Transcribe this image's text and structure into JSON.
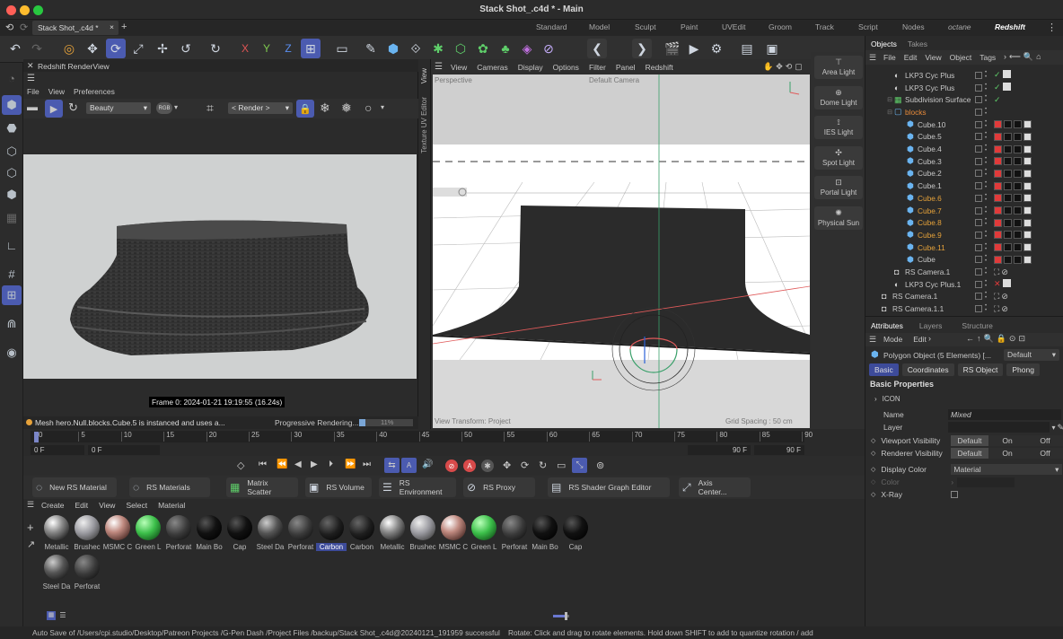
{
  "window": {
    "title": "Stack Shot_.c4d * - Main",
    "doc_tab": "Stack Shot_.c4d *",
    "add_tab": "+"
  },
  "workspaces": [
    "Standard",
    "Model",
    "Sculpt",
    "Paint",
    "UVEdit",
    "Groom",
    "Track",
    "Script",
    "Nodes",
    "octane",
    "Redshift"
  ],
  "axes": {
    "x": "X",
    "y": "Y",
    "z": "Z"
  },
  "renderview": {
    "title": "Redshift RenderView",
    "menu": [
      "File",
      "View",
      "Preferences"
    ],
    "aov": "Beauty",
    "mode": "RGB",
    "camera": "< Render >",
    "frame_info": "Frame  0:  2024-01-21  19:19:55  (16.24s)",
    "message": "Mesh hero.Null.blocks.Cube.5 is instanced and uses a...",
    "progress_label": "Progressive Rendering...",
    "progress_pct": "11%",
    "progress": 0.11
  },
  "viewport": {
    "menu": [
      "View",
      "Cameras",
      "Display",
      "Options",
      "Filter",
      "Panel",
      "Redshift"
    ],
    "label_perspective": "Perspective",
    "label_camera": "Default Camera",
    "label_transform": "View Transform: Project",
    "grid_spacing": "Grid Spacing : 50 cm",
    "side_tab_view": "View",
    "side_tab_uv": "Texture UV Editor"
  },
  "lights": [
    {
      "label": "Area Light"
    },
    {
      "label": "Dome Light"
    },
    {
      "label": "IES Light"
    },
    {
      "label": "Spot Light"
    },
    {
      "label": "Portal Light"
    },
    {
      "label": "Physical Sun"
    }
  ],
  "objects_panel": {
    "tabs": [
      "Objects",
      "Takes"
    ],
    "menu": [
      "File",
      "Edit",
      "View",
      "Object",
      "Tags"
    ],
    "rows": [
      {
        "name": "LKP3 Cyc Plus",
        "indent": 1,
        "color": "#c8c8c8",
        "type": "cyc"
      },
      {
        "name": "LKP3 Cyc Plus",
        "indent": 1,
        "color": "#c8c8c8",
        "type": "cyc"
      },
      {
        "name": "Subdivision Surface",
        "indent": 1,
        "color": "#c8c8c8",
        "type": "subd"
      },
      {
        "name": "blocks",
        "indent": 1,
        "color": "#e68a3a",
        "type": "null"
      },
      {
        "name": "Cube.10",
        "indent": 2,
        "color": "#c8c8c8",
        "type": "cube"
      },
      {
        "name": "Cube.5",
        "indent": 2,
        "color": "#c8c8c8",
        "type": "cube"
      },
      {
        "name": "Cube.4",
        "indent": 2,
        "color": "#c8c8c8",
        "type": "cube"
      },
      {
        "name": "Cube.3",
        "indent": 2,
        "color": "#c8c8c8",
        "type": "cube"
      },
      {
        "name": "Cube.2",
        "indent": 2,
        "color": "#c8c8c8",
        "type": "cube"
      },
      {
        "name": "Cube.1",
        "indent": 2,
        "color": "#c8c8c8",
        "type": "cube"
      },
      {
        "name": "Cube.6",
        "indent": 2,
        "color": "#e6a23a",
        "type": "cube"
      },
      {
        "name": "Cube.7",
        "indent": 2,
        "color": "#e6a23a",
        "type": "cube"
      },
      {
        "name": "Cube.8",
        "indent": 2,
        "color": "#e6a23a",
        "type": "cube"
      },
      {
        "name": "Cube.9",
        "indent": 2,
        "color": "#e6a23a",
        "type": "cube"
      },
      {
        "name": "Cube.11",
        "indent": 2,
        "color": "#e6a23a",
        "type": "cube"
      },
      {
        "name": "Cube",
        "indent": 2,
        "color": "#c8c8c8",
        "type": "cube"
      },
      {
        "name": "RS Camera.1",
        "indent": 1,
        "color": "#c8c8c8",
        "type": "cam"
      },
      {
        "name": "LKP3 Cyc Plus.1",
        "indent": 1,
        "color": "#c8c8c8",
        "type": "cyc"
      },
      {
        "name": "RS Camera.1",
        "indent": 0,
        "color": "#c8c8c8",
        "type": "cam"
      },
      {
        "name": "RS Camera.1.1",
        "indent": 0,
        "color": "#c8c8c8",
        "type": "cam"
      }
    ]
  },
  "attributes": {
    "tabs": [
      "Attributes",
      "Layers",
      "Structure"
    ],
    "menu": [
      "Mode",
      "Edit"
    ],
    "object_label": "Polygon Object (5 Elements) [...",
    "preset": "Default",
    "subtabs": [
      "Basic",
      "Coordinates",
      "RS Object",
      "Phong"
    ],
    "section": "Basic Properties",
    "icon_row": "ICON",
    "name_label": "Name",
    "name_value": "Mixed",
    "layer_label": "Layer",
    "viewport_vis": "Viewport Visibility",
    "renderer_vis": "Renderer Visibility",
    "vis_options": [
      "Default",
      "On",
      "Off"
    ],
    "display_color": "Display Color",
    "display_color_value": "Material",
    "color_label": "Color",
    "xray_label": "X-Ray"
  },
  "timeline": {
    "ticks": [
      "0",
      "5",
      "10",
      "15",
      "20",
      "25",
      "30",
      "35",
      "40",
      "45",
      "50",
      "55",
      "60",
      "65",
      "70",
      "75",
      "80",
      "85",
      "90"
    ],
    "start": "0 F",
    "current": "0 F",
    "end": "90 F",
    "end2": "90 F"
  },
  "rs_toolbar": [
    {
      "label": "New RS Material"
    },
    {
      "label": "RS Materials"
    },
    {
      "label": "Matrix Scatter"
    },
    {
      "label": "RS Volume"
    },
    {
      "label": "RS Environment"
    },
    {
      "label": "RS Proxy"
    },
    {
      "label": "RS Shader Graph Editor"
    },
    {
      "label": "Axis Center..."
    }
  ],
  "material_menu": [
    "Create",
    "Edit",
    "View",
    "Select",
    "Material"
  ],
  "materials": [
    {
      "label": "Metallic",
      "style": "metal"
    },
    {
      "label": "Brushec",
      "style": "brushed"
    },
    {
      "label": "MSMC C",
      "style": "copper"
    },
    {
      "label": "Green L",
      "style": "green"
    },
    {
      "label": "Perforat",
      "style": "perf"
    },
    {
      "label": "Main Bo",
      "style": "black"
    },
    {
      "label": "Cap",
      "style": "black"
    },
    {
      "label": "Steel Da",
      "style": "steel"
    },
    {
      "label": "Perforat",
      "style": "perf"
    },
    {
      "label": "Carbon",
      "style": "carbon",
      "selected": true
    },
    {
      "label": "Carbon",
      "style": "carbon"
    },
    {
      "label": "Metallic",
      "style": "metal"
    },
    {
      "label": "Brushec",
      "style": "brushed"
    },
    {
      "label": "MSMC C",
      "style": "copper"
    },
    {
      "label": "Green L",
      "style": "green"
    },
    {
      "label": "Perforat",
      "style": "perf"
    },
    {
      "label": "Main Bo",
      "style": "black"
    },
    {
      "label": "Cap",
      "style": "black"
    },
    {
      "label": "Steel Da",
      "style": "steel"
    },
    {
      "label": "Perforat",
      "style": "perf"
    }
  ],
  "status": {
    "left": "Auto Save of /Users/cpi.studio/Desktop/Patreon Projects /G-Pen Dash /Project Files /backup/Stack Shot_.c4d@20240121_191959 successful",
    "right": "Rotate: Click and drag to rotate elements. Hold down SHIFT to add to quantize rotation / add t"
  },
  "colors": {
    "accent": "#4b5bb0",
    "selected_tab": "#3d4b9a",
    "orange": "#e6a23a"
  }
}
